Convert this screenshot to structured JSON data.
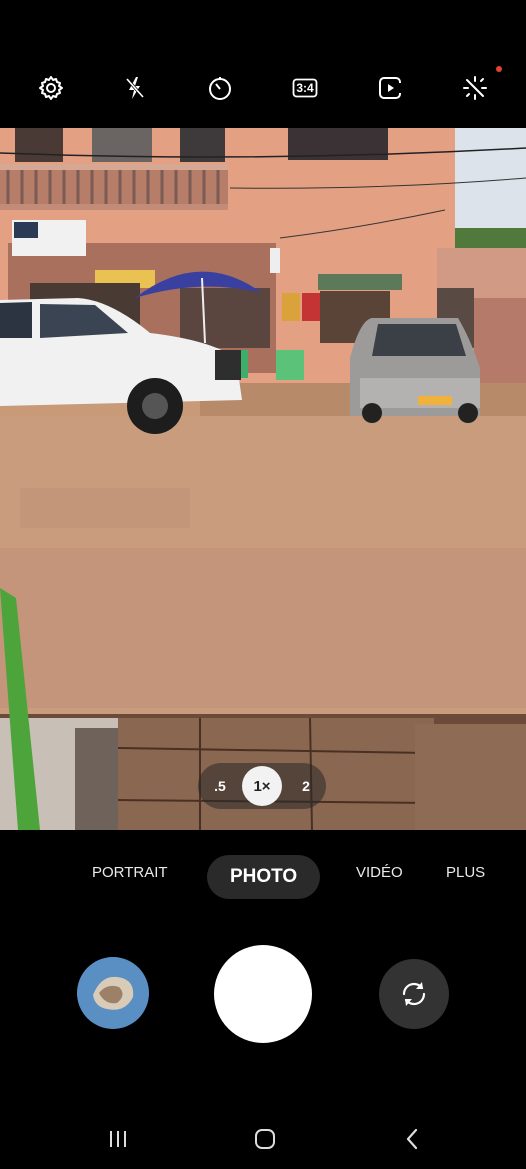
{
  "top_toolbar": {
    "icons": [
      "settings-icon",
      "flash-off-icon",
      "timer-icon",
      "aspect-ratio-icon",
      "motion-photo-icon",
      "filters-icon"
    ],
    "aspect_ratio_label": "3:4",
    "notification_dot_color": "#e0452c"
  },
  "zoom": {
    "options": [
      ".5",
      "1×",
      "2"
    ],
    "selected": "1×"
  },
  "modes": {
    "items": [
      "PORTRAIT",
      "PHOTO",
      "VIDÉO",
      "PLUS"
    ],
    "selected": "PHOTO"
  },
  "controls": {
    "gallery_thumbnail": "gallery-thumbnail",
    "shutter": "shutter-button",
    "switch_camera": "switch-camera-icon"
  },
  "navigation": {
    "icons": [
      "recent-apps-icon",
      "home-icon",
      "back-icon"
    ]
  }
}
